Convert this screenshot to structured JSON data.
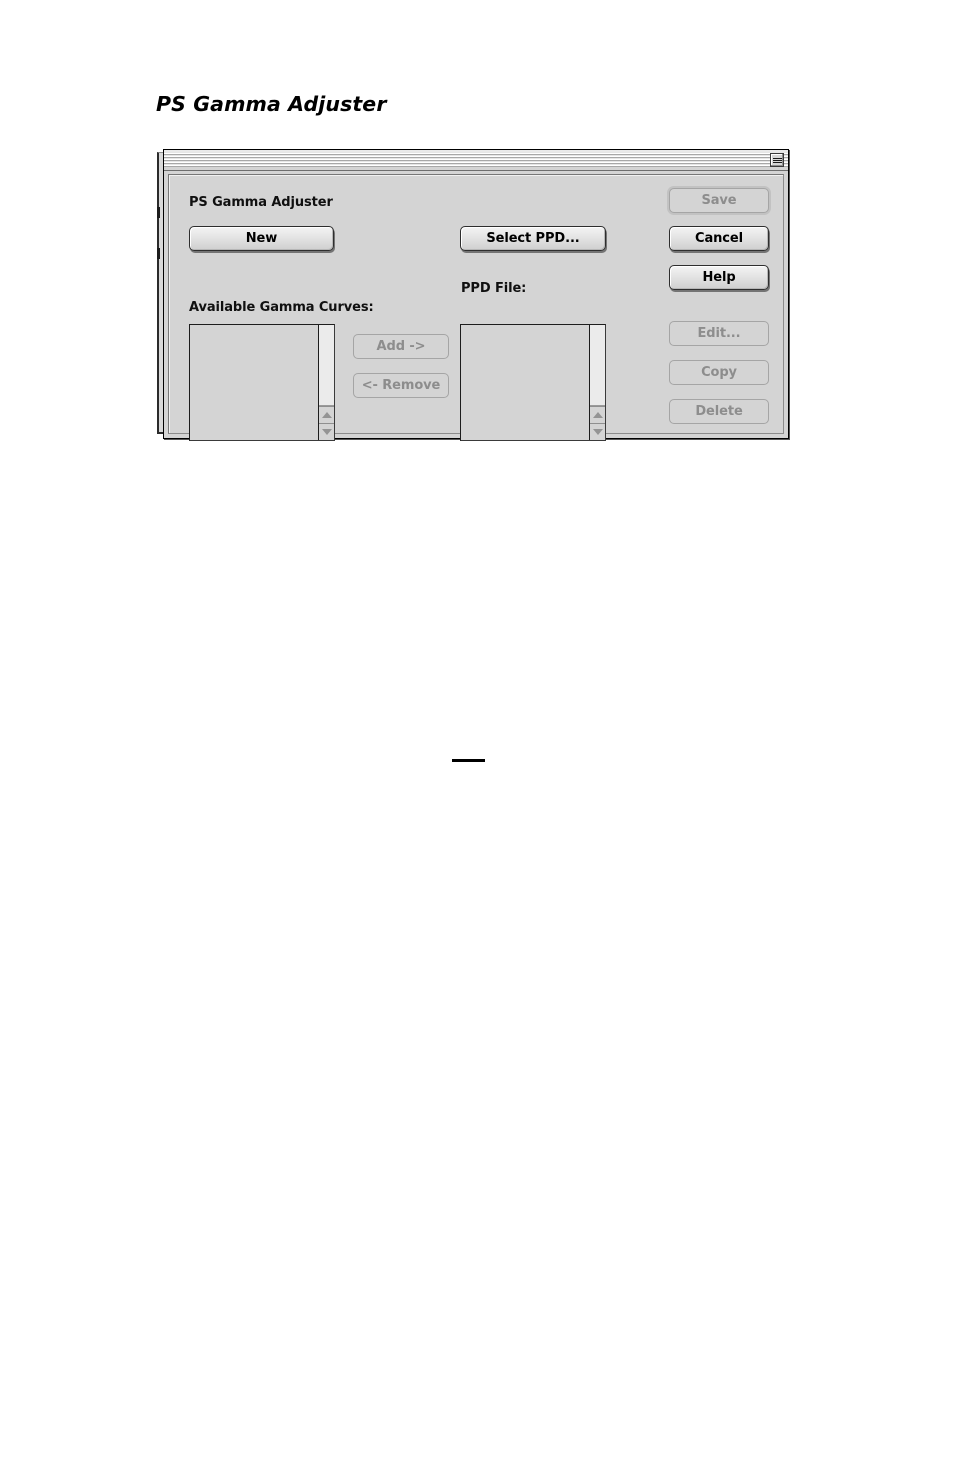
{
  "page": {
    "heading": "PS Gamma Adjuster",
    "page_rule_artifact": true
  },
  "dialog": {
    "titlebar": {
      "collapse_icon": "windowshade-box-icon"
    },
    "title_label": "PS Gamma Adjuster",
    "labels": {
      "available_gamma_curves": "Available Gamma Curves:",
      "ppd_file": "PPD File:"
    },
    "buttons": {
      "new": {
        "label": "New",
        "enabled": true
      },
      "select_ppd": {
        "label": "Select PPD...",
        "enabled": true
      },
      "save": {
        "label": "Save",
        "enabled": false
      },
      "cancel": {
        "label": "Cancel",
        "enabled": true
      },
      "help": {
        "label": "Help",
        "enabled": true
      },
      "edit": {
        "label": "Edit...",
        "enabled": false
      },
      "copy": {
        "label": "Copy",
        "enabled": false
      },
      "delete": {
        "label": "Delete",
        "enabled": false
      },
      "add": {
        "label": "Add ->",
        "enabled": false
      },
      "remove": {
        "label": "<- Remove",
        "enabled": false
      }
    },
    "lists": {
      "gamma_curves": {
        "items": []
      },
      "ppd_file": {
        "items": []
      }
    },
    "colors": {
      "window_face": "#d4d4d4",
      "button_text": "#000000",
      "disabled_text": "#8d8d8d",
      "frame": "#000000",
      "scroll_track": "#ebebeb"
    }
  }
}
